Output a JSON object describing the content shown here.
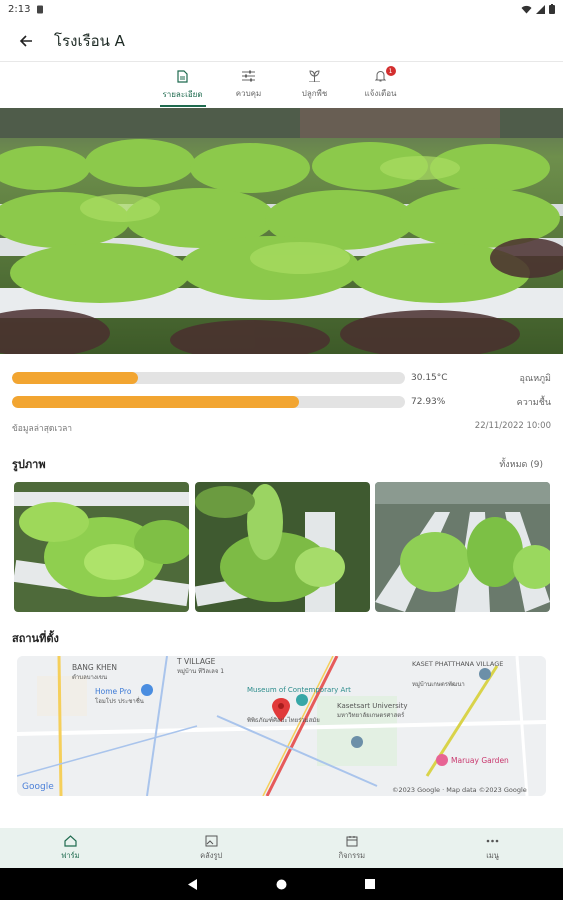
{
  "status_bar": {
    "time": "2:13"
  },
  "app_bar": {
    "title": "โรงเรือน A"
  },
  "tabs": [
    {
      "label": "รายละเอียด",
      "icon": "document-icon",
      "active": true
    },
    {
      "label": "ควบคุม",
      "icon": "sliders-icon",
      "active": false
    },
    {
      "label": "ปลูกพืช",
      "icon": "sprout-icon",
      "active": false
    },
    {
      "label": "แจ้งเตือน",
      "icon": "bell-icon",
      "active": false,
      "badge": "1"
    }
  ],
  "metrics": [
    {
      "value_text": "30.15°C",
      "label": "อุณหภูมิ",
      "fill_percent": 32
    },
    {
      "value_text": "72.93%",
      "label": "ความชื้น",
      "fill_percent": 73
    }
  ],
  "last_update": {
    "label": "ข้อมูลล่าสุดเวลา",
    "datetime": "22/11/2022 10:00"
  },
  "photos": {
    "title": "รูปภาพ",
    "see_all": "ทั้งหมด (9)"
  },
  "location": {
    "title": "สถานที่ตั้ง",
    "map_labels": {
      "bang_khen": "BANG KHEN",
      "bang_khen_th": "ตำบลบางเขน",
      "home_pro": "Home Pro",
      "home_pro_th": "โฮมโปร ประชาชื่น",
      "village": "T VILLAGE",
      "village_th": "หมู่บ้าน ทีวิลเลจ 1",
      "museum": "Museum of Contemporary Art",
      "museum_th": "พิพิธภัณฑ์ศิลปะไทยร่วมสมัย",
      "kasetsart": "Kasetsart University",
      "kasetsart_th": "มหาวิทยาลัยเกษตรศาสตร์",
      "kaset_village": "KASET PHATTHANA VILLAGE",
      "kaset_village_th": "หมู่บ้านเกษตรพัฒนา",
      "maruay": "Maruay Garden",
      "google": "Google",
      "copyright": "©2023 Google · Map data ©2023 Google"
    }
  },
  "bottom_nav": [
    {
      "label": "ฟาร์ม",
      "icon": "home-icon",
      "active": true
    },
    {
      "label": "คลังรูป",
      "icon": "gallery-icon",
      "active": false
    },
    {
      "label": "กิจกรรม",
      "icon": "calendar-icon",
      "active": false
    },
    {
      "label": "เมนู",
      "icon": "more-icon",
      "active": false
    }
  ],
  "colors": {
    "accent": "#1f6b4f",
    "bar": "#f2a531",
    "track": "#e3e3e3"
  }
}
